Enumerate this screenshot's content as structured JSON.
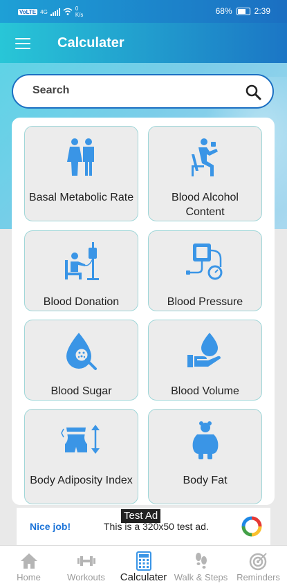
{
  "status_bar": {
    "network": "VoLTE",
    "signal_label": "4G",
    "speed_value": "0",
    "speed_unit": "K/s",
    "battery": "68%",
    "time": "2:39"
  },
  "app_bar": {
    "title": "Calculater"
  },
  "search": {
    "placeholder": "Search"
  },
  "calculators": [
    {
      "label": "Basal Metabolic Rate",
      "icon": "couple-icon"
    },
    {
      "label": "Blood Alcohol Content",
      "icon": "drinking-person-icon"
    },
    {
      "label": "Blood Donation",
      "icon": "blood-donation-icon"
    },
    {
      "label": "Blood Pressure",
      "icon": "blood-pressure-monitor-icon"
    },
    {
      "label": "Blood Sugar",
      "icon": "blood-sugar-drop-icon"
    },
    {
      "label": "Blood Volume",
      "icon": "hand-drop-icon"
    },
    {
      "label": "Body Adiposity Index",
      "icon": "waist-measure-icon"
    },
    {
      "label": "Body Fat",
      "icon": "body-fat-icon"
    }
  ],
  "ad": {
    "badge": "Test Ad",
    "nice": "Nice job!",
    "text": "This is a 320x50 test ad."
  },
  "bottom_nav": [
    {
      "label": "Home",
      "icon": "home-icon",
      "active": false
    },
    {
      "label": "Workouts",
      "icon": "dumbbell-icon",
      "active": false
    },
    {
      "label": "Calculater",
      "icon": "calculator-icon",
      "active": true
    },
    {
      "label": "Walk & Steps",
      "icon": "footsteps-icon",
      "active": false
    },
    {
      "label": "Reminders",
      "icon": "target-icon",
      "active": false
    }
  ],
  "colors": {
    "accent": "#3a95e6",
    "app_bar_start": "#28c6d7",
    "app_bar_end": "#1b76c5",
    "nav_active": "#3a95e6",
    "nav_inactive": "#b5b5b5"
  }
}
